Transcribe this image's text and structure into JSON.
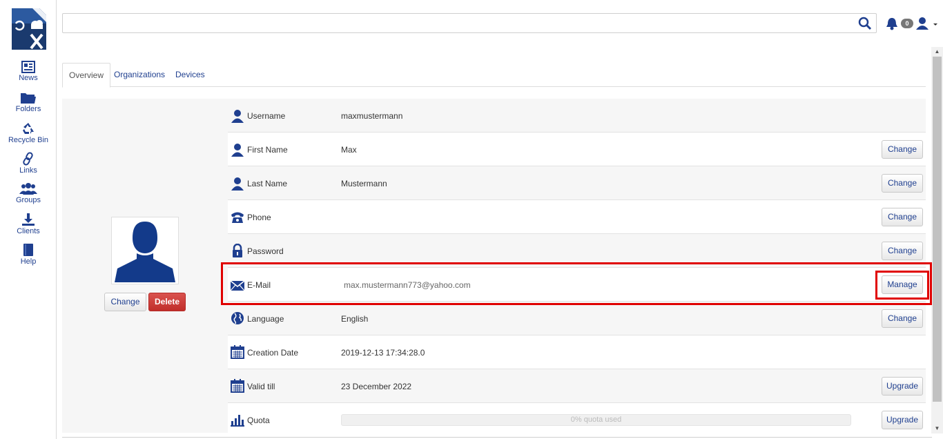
{
  "nav": {
    "items": [
      {
        "label": "News",
        "icon": "news-icon"
      },
      {
        "label": "Folders",
        "icon": "folder-icon"
      },
      {
        "label": "Recycle Bin",
        "icon": "recycle-icon"
      },
      {
        "label": "Links",
        "icon": "link-icon"
      },
      {
        "label": "Groups",
        "icon": "groups-icon"
      },
      {
        "label": "Clients",
        "icon": "download-icon"
      },
      {
        "label": "Help",
        "icon": "book-icon"
      }
    ]
  },
  "header": {
    "search_value": "",
    "notification_count": "0"
  },
  "tabs": [
    {
      "label": "Overview",
      "active": true
    },
    {
      "label": "Organizations",
      "active": false
    },
    {
      "label": "Devices",
      "active": false
    }
  ],
  "profile": {
    "change_label": "Change",
    "delete_label": "Delete"
  },
  "details": [
    {
      "label": "Username",
      "value": "maxmustermann",
      "icon": "user-icon",
      "button": ""
    },
    {
      "label": "First Name",
      "value": "Max",
      "icon": "user-icon",
      "button": "Change"
    },
    {
      "label": "Last Name",
      "value": "Mustermann",
      "icon": "user-icon",
      "button": "Change"
    },
    {
      "label": "Phone",
      "value": "",
      "icon": "phone-icon",
      "button": "Change"
    },
    {
      "label": "Password",
      "value": "",
      "icon": "lock-icon",
      "button": "Change"
    },
    {
      "label": "E-Mail",
      "value": "max.mustermann773@yahoo.com",
      "icon": "envelope-icon",
      "button": "Manage"
    },
    {
      "label": "Language",
      "value": "English",
      "icon": "globe-icon",
      "button": "Change"
    },
    {
      "label": "Creation Date",
      "value": "2019-12-13 17:34:28.0",
      "icon": "calendar-icon",
      "button": ""
    },
    {
      "label": "Valid till",
      "value": "23 December 2022",
      "icon": "calendar-icon",
      "button": "Upgrade"
    },
    {
      "label": "Quota",
      "value": "0% quota used",
      "icon": "bar-chart-icon",
      "button": "Upgrade"
    }
  ],
  "quota": {
    "used_fraction": 0
  },
  "colors": {
    "accent": "#1f3f8f",
    "danger": "#c9302c",
    "highlight": "#e00000"
  }
}
